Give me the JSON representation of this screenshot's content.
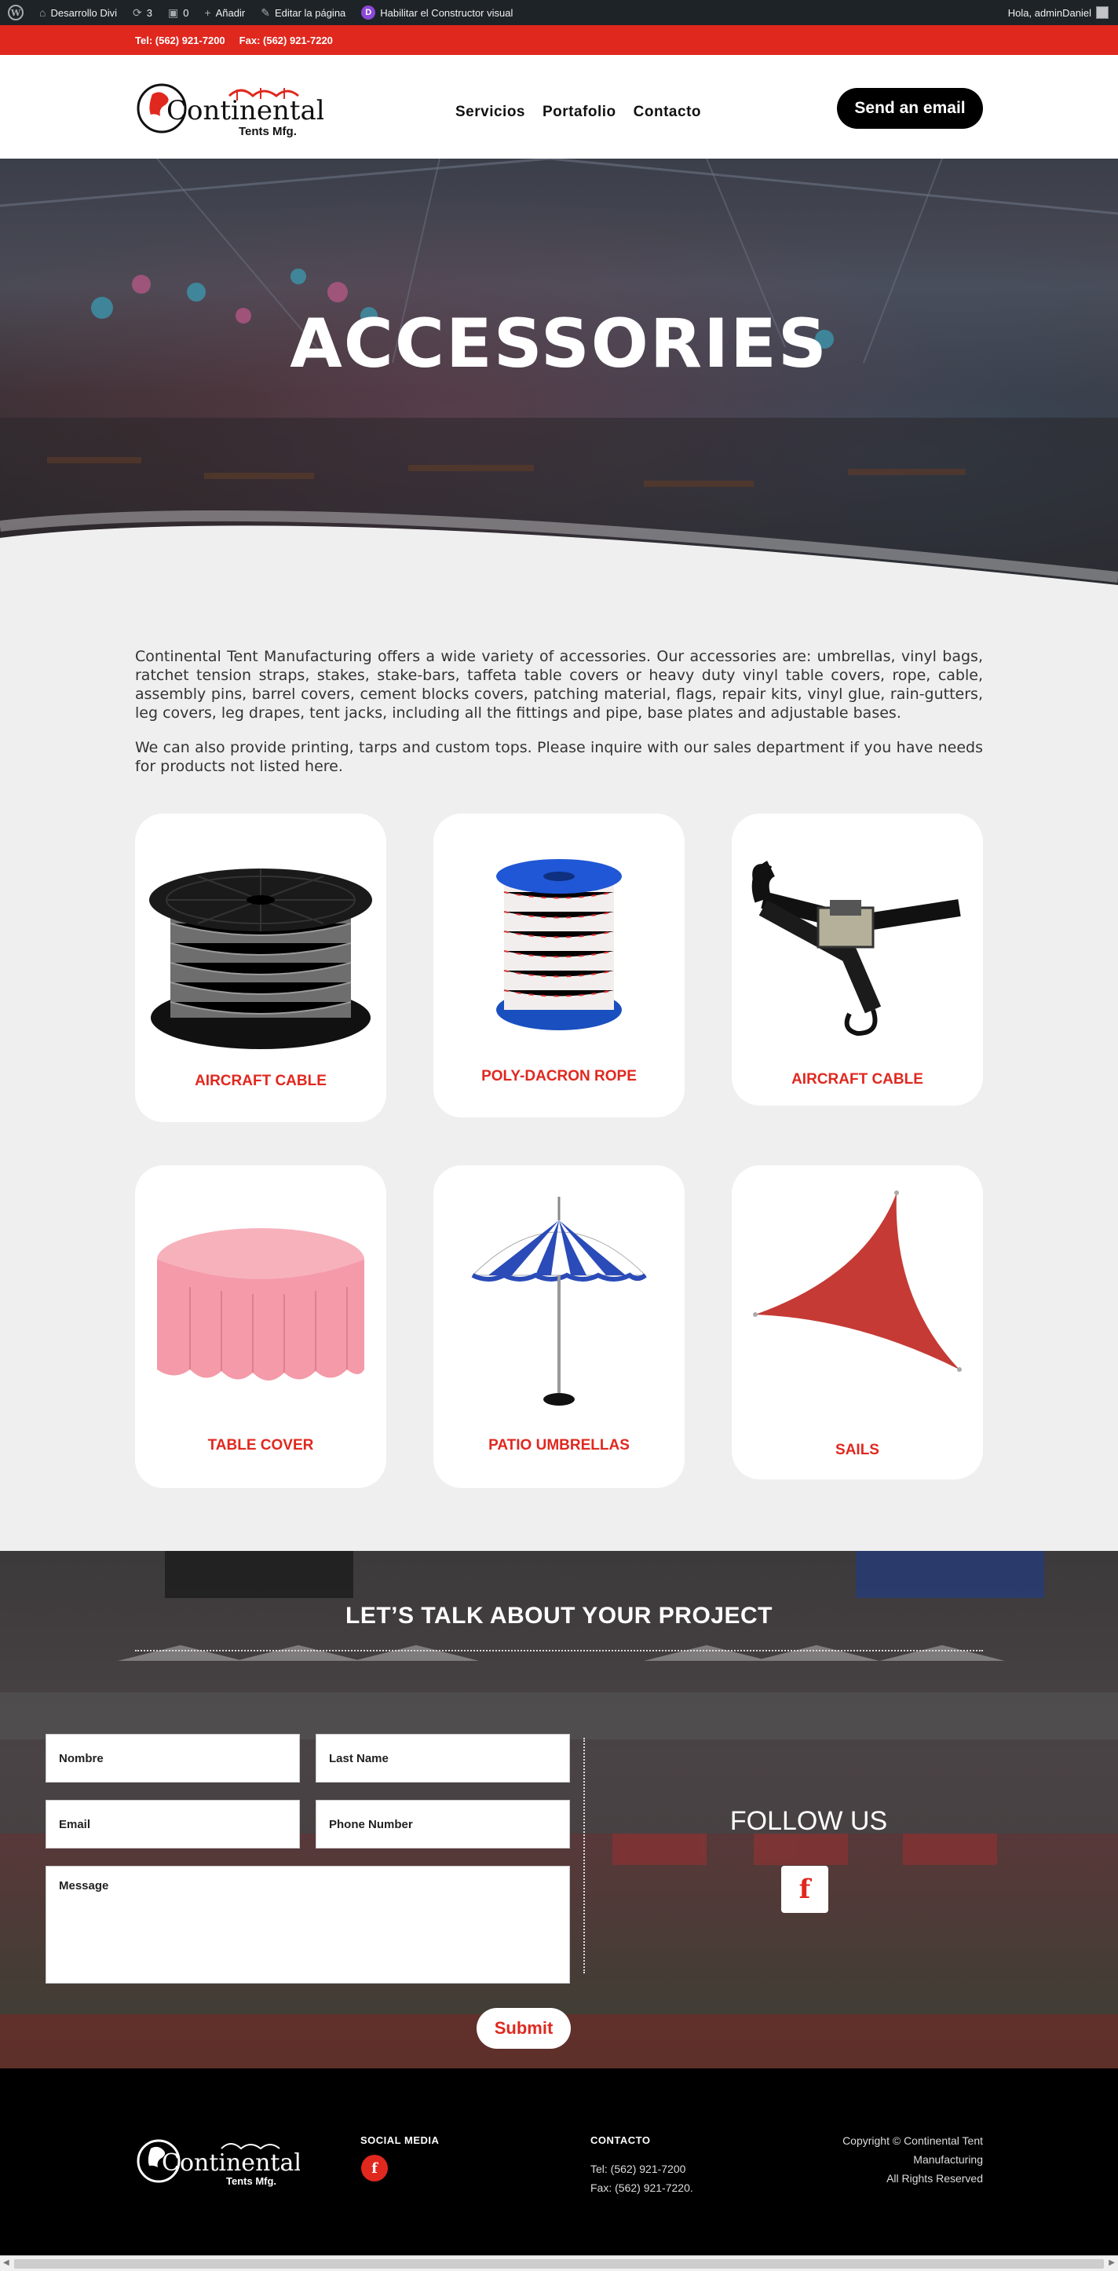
{
  "admin_bar": {
    "site_name": "Desarrollo Divi",
    "updates_count": "3",
    "comments_count": "0",
    "add_new": "Añadir",
    "edit_page": "Editar la página",
    "visual_builder": "Habilitar el Constructor visual",
    "greeting": "Hola, adminDaniel"
  },
  "top_bar": {
    "phone": "Tel: (562) 921-7200",
    "fax": "Fax:  (562) 921-7220"
  },
  "header": {
    "logo_text": "Continental",
    "logo_subtext": "Tents Mfg.",
    "nav": [
      "Servicios",
      "Portafolio",
      "Contacto"
    ],
    "cta_label": "Send an email"
  },
  "hero": {
    "title": "ACCESSORIES"
  },
  "intro": {
    "paragraph1": "Continental Tent Manufacturing offers a wide variety of accessories. Our accessories are: umbrellas, vinyl bags, ratchet tension straps, stakes, stake-bars, taffeta table covers or heavy duty vinyl table covers, rope, cable, assembly pins, barrel covers, cement blocks covers, patching material, flags, repair kits, vinyl glue, rain-gutters, leg covers, leg drapes, tent jacks, including all the fittings and pipe, base plates and adjustable bases.",
    "paragraph2": "We can also provide printing, tarps and custom tops. Please inquire with our sales department if you have needs for products not listed here."
  },
  "products": [
    {
      "label": "AIRCRAFT CABLE",
      "icon": "cable-spool-image"
    },
    {
      "label": "POLY-DACRON ROPE",
      "icon": "rope-spool-image"
    },
    {
      "label": "AIRCRAFT CABLE",
      "icon": "ratchet-strap-image"
    },
    {
      "label": "TABLE COVER",
      "icon": "table-cover-image"
    },
    {
      "label": "PATIO UMBRELLAS",
      "icon": "patio-umbrella-image"
    },
    {
      "label": "SAILS",
      "icon": "shade-sail-image"
    }
  ],
  "contact": {
    "title": "LET’S TALK ABOUT YOUR PROJECT",
    "first_name_placeholder": "Nombre",
    "last_name_placeholder": "Last Name",
    "email_placeholder": "Email",
    "phone_placeholder": "Phone Number",
    "message_placeholder": "Message",
    "submit_label": "Submit",
    "follow_title": "FOLLOW US"
  },
  "footer": {
    "social_heading": "SOCIAL MEDIA",
    "contact_heading": "CONTACTO",
    "tel": "Tel: (562) 921-7200",
    "fax": "Fax: (562) 921-7220.",
    "copyright_line1": "Copyright © Continental Tent",
    "copyright_line2": "Manufacturing",
    "copyright_line3": "All Rights Reserved"
  },
  "colors": {
    "brand_red": "#e0281f",
    "admin_bar": "#1d2327",
    "footer": "#000000"
  }
}
